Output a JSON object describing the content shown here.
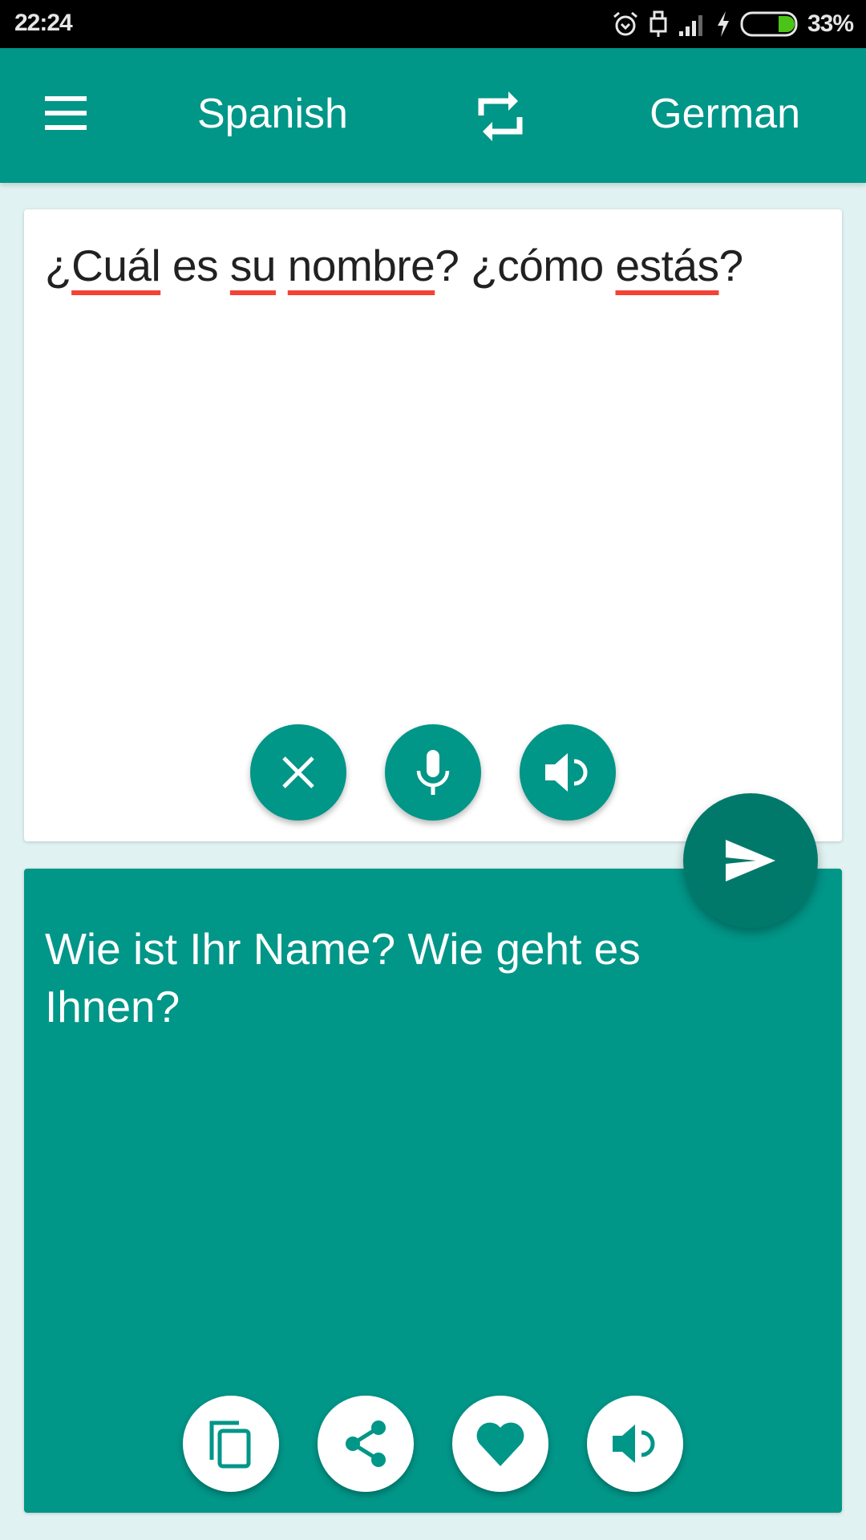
{
  "status_bar": {
    "time": "22:24",
    "battery_percent": "33%",
    "battery_level": 0.33,
    "icons": [
      "alarm-icon",
      "usb-icon",
      "signal-icon",
      "charging-icon",
      "battery-icon"
    ]
  },
  "app_bar": {
    "menu_icon": "menu-icon",
    "source_language": "Spanish",
    "swap_icon": "swap-icon",
    "target_language": "German"
  },
  "source": {
    "words": [
      {
        "text": "¿",
        "misspelled": false
      },
      {
        "text": "Cuál",
        "misspelled": true
      },
      {
        "text": " es ",
        "misspelled": false
      },
      {
        "text": "su",
        "misspelled": true
      },
      {
        "text": " ",
        "misspelled": false
      },
      {
        "text": "nombre",
        "misspelled": true
      },
      {
        "text": "? ¿cómo ",
        "misspelled": false
      },
      {
        "text": "estás",
        "misspelled": true
      },
      {
        "text": "?",
        "misspelled": false
      }
    ],
    "actions": [
      "clear",
      "microphone",
      "speak"
    ]
  },
  "translate_button": {
    "icon": "send-icon"
  },
  "target": {
    "text": "Wie ist Ihr Name? Wie geht es Ihnen?",
    "actions": [
      "copy",
      "share",
      "favorite",
      "speak"
    ]
  },
  "colors": {
    "primary": "#009688",
    "primary_dark": "#00796b",
    "background": "#e0f2f1",
    "spell_error": "#f44336",
    "battery_fill": "#4cc417"
  }
}
